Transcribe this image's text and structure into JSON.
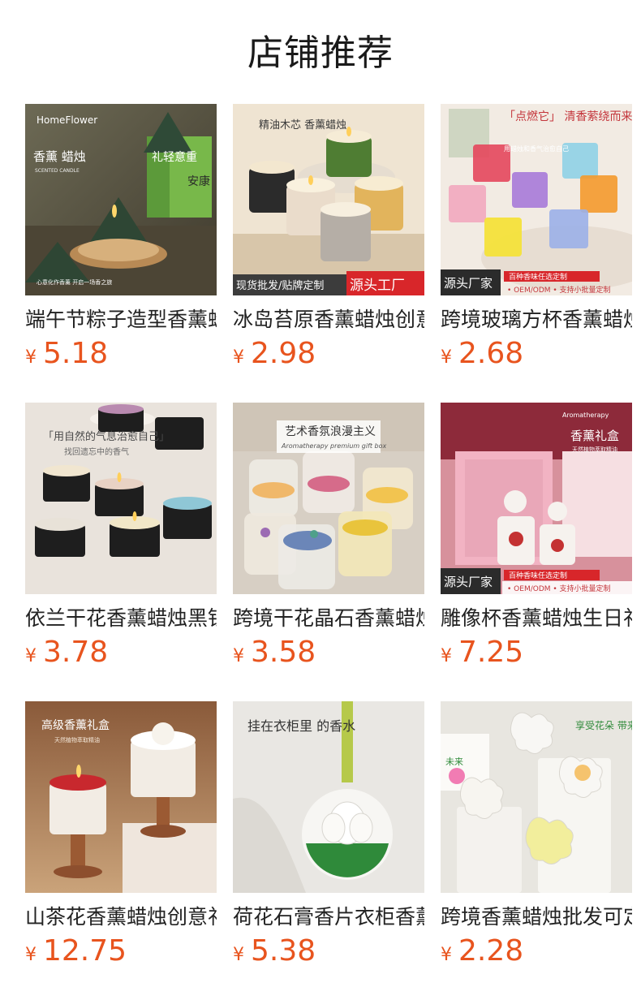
{
  "page": {
    "title": "店铺推荐"
  },
  "products": [
    {
      "name": "端午节粽子造型香薰蜡烛",
      "currency": "¥",
      "price": "5.18",
      "image": {
        "brand": "HomeFlower",
        "headline": "香薰 蜡烛",
        "sub": "SCENTED CANDLE",
        "box_text": "礼轻意重",
        "box_side": "安康",
        "foot": "心意化作香薰 开启一场香之旅"
      }
    },
    {
      "name": "冰岛苔原香薰蜡烛创意",
      "currency": "¥",
      "price": "2.98",
      "image": {
        "headline": "精油木芯 香薰蜡烛",
        "badge_left": "现货批发/贴牌定制",
        "badge_right": "源头工厂"
      }
    },
    {
      "name": "跨境玻璃方杯香薰蜡烛",
      "currency": "¥",
      "price": "2.68",
      "image": {
        "headline": "「点燃它」 清香萦绕而来",
        "sub": "用蜡烛和香气治愈自己",
        "badge_left": "源头厂家",
        "badge_top": "百种香味任选定制",
        "badge_bottom": "• OEM/ODM • 支持小批量定制"
      }
    },
    {
      "name": "依兰干花香薰蜡烛黑铁",
      "currency": "¥",
      "price": "3.78",
      "image": {
        "headline": "「用自然的气息治愈自己」",
        "sub": "找回遗忘中的香气"
      }
    },
    {
      "name": "跨境干花晶石香薰蜡烛",
      "currency": "¥",
      "price": "3.58",
      "image": {
        "headline": "艺术香氛浪漫主义",
        "sub": "Aromatherapy premium gift box"
      }
    },
    {
      "name": "雕像杯香薰蜡烛生日礼",
      "currency": "¥",
      "price": "7.25",
      "image": {
        "brand": "Aromatherapy",
        "headline": "香薰礼盒",
        "sub": "天然植物萃取精油",
        "badge_left": "源头厂家",
        "badge_top": "百种香味任选定制",
        "badge_bottom": "• OEM/ODM • 支持小批量定制"
      }
    },
    {
      "name": "山茶花香薰蜡烛创意礼",
      "currency": "¥",
      "price": "12.75",
      "image": {
        "headline": "高级香薰礼盒",
        "sub": "天然植物萃取精油"
      }
    },
    {
      "name": "荷花石膏香片衣柜香薰",
      "currency": "¥",
      "price": "5.38",
      "image": {
        "headline": "挂在衣柜里 的香水"
      }
    },
    {
      "name": "跨境香薰蜡烛批发可定",
      "currency": "¥",
      "price": "2.28",
      "image": {
        "headline": "享受花朵 带来的芳香",
        "box_text": "未来"
      }
    }
  ],
  "colors": {
    "price": "#e8541e",
    "title": "#1a1a1a",
    "badge_red": "#d8262a"
  }
}
